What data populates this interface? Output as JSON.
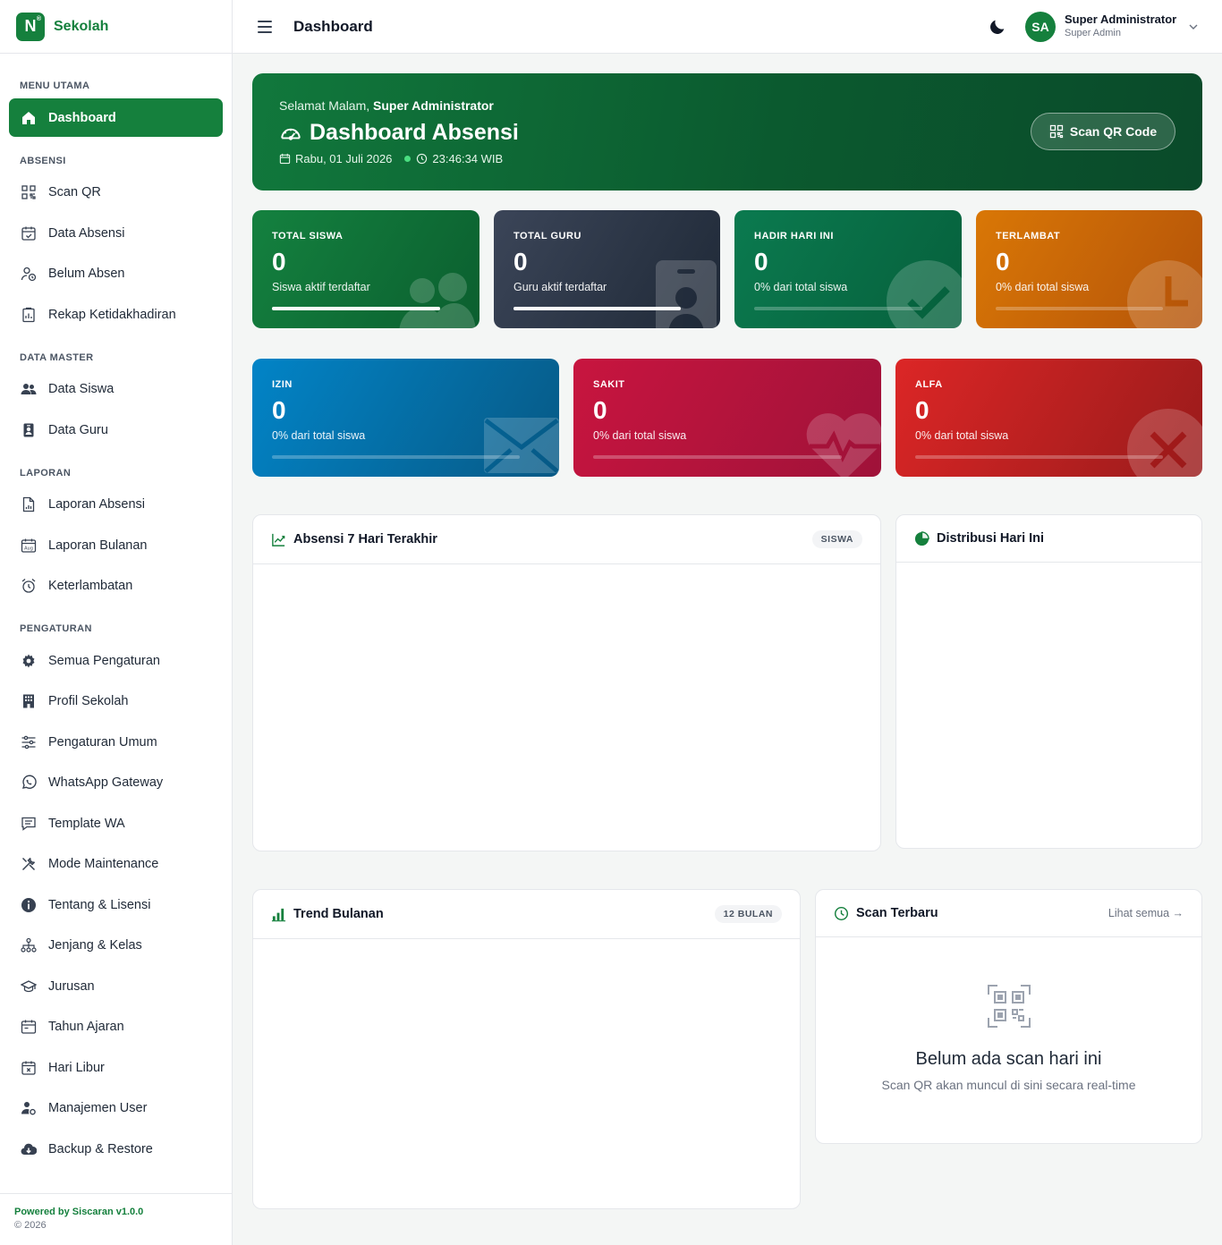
{
  "brand": {
    "logo_letter": "N",
    "logo_mark": "®",
    "name": "Sekolah"
  },
  "sidebar": {
    "sections": [
      {
        "title": "MENU UTAMA",
        "items": [
          {
            "label": "Dashboard",
            "icon": "home-icon",
            "active": true
          }
        ]
      },
      {
        "title": "ABSENSI",
        "items": [
          {
            "label": "Scan QR",
            "icon": "qr-code-icon"
          },
          {
            "label": "Data Absensi",
            "icon": "calendar-check-icon"
          },
          {
            "label": "Belum Absen",
            "icon": "user-clock-icon"
          },
          {
            "label": "Rekap Ketidakhadiran",
            "icon": "report-icon"
          }
        ]
      },
      {
        "title": "DATA MASTER",
        "items": [
          {
            "label": "Data Siswa",
            "icon": "users-icon"
          },
          {
            "label": "Data Guru",
            "icon": "id-badge-icon"
          }
        ]
      },
      {
        "title": "LAPORAN",
        "items": [
          {
            "label": "Laporan Absensi",
            "icon": "file-chart-icon"
          },
          {
            "label": "Laporan Bulanan",
            "icon": "calendar-month-icon"
          },
          {
            "label": "Keterlambatan",
            "icon": "alarm-icon"
          }
        ]
      },
      {
        "title": "PENGATURAN",
        "items": [
          {
            "label": "Semua Pengaturan",
            "icon": "gear-icon"
          },
          {
            "label": "Profil Sekolah",
            "icon": "building-icon"
          },
          {
            "label": "Pengaturan Umum",
            "icon": "sliders-icon"
          },
          {
            "label": "WhatsApp Gateway",
            "icon": "whatsapp-icon"
          },
          {
            "label": "Template WA",
            "icon": "message-icon"
          },
          {
            "label": "Mode Maintenance",
            "icon": "tools-icon"
          },
          {
            "label": "Tentang & Lisensi",
            "icon": "info-icon"
          },
          {
            "label": "Jenjang & Kelas",
            "icon": "hierarchy-icon"
          },
          {
            "label": "Jurusan",
            "icon": "graduation-cap-icon"
          },
          {
            "label": "Tahun Ajaran",
            "icon": "calendar-range-icon"
          },
          {
            "label": "Hari Libur",
            "icon": "calendar-x-icon"
          },
          {
            "label": "Manajemen User",
            "icon": "user-gear-icon"
          },
          {
            "label": "Backup & Restore",
            "icon": "cloud-download-icon"
          }
        ]
      }
    ],
    "footer": {
      "powered": "Powered by Siscaran v1.0.0",
      "copyright": "© 2026"
    }
  },
  "topbar": {
    "title": "Dashboard",
    "user_initials": "SA",
    "user_name": "Super Administrator",
    "user_role": "Super Admin"
  },
  "hero": {
    "greeting_prefix": "Selamat Malam, ",
    "greeting_name": "Super Administrator",
    "title": "Dashboard Absensi",
    "date": "Rabu, 01 Juli 2026",
    "time": "23:46:34 WIB",
    "button_label": "Scan QR Code"
  },
  "stats": [
    {
      "label": "TOTAL SISWA",
      "value": "0",
      "sub": "Siswa aktif terdaftar",
      "progress": 1.0,
      "color_from": "#14813f",
      "color_to": "#0b5f2f"
    },
    {
      "label": "TOTAL GURU",
      "value": "0",
      "sub": "Guru aktif terdaftar",
      "progress": 1.0,
      "color_from": "#3b4558",
      "color_to": "#1f2937"
    },
    {
      "label": "HADIR HARI INI",
      "value": "0",
      "sub": "0% dari total siswa",
      "progress": 0,
      "color_from": "#0b7a4f",
      "color_to": "#06603c"
    },
    {
      "label": "TERLAMBAT",
      "value": "0",
      "sub": "0% dari total siswa",
      "progress": 0,
      "color_from": "#d97706",
      "color_to": "#b45309"
    },
    {
      "label": "IZIN",
      "value": "0",
      "sub": "0% dari total siswa",
      "progress": 0,
      "color_from": "#0284c7",
      "color_to": "#075985"
    },
    {
      "label": "SAKIT",
      "value": "0",
      "sub": "0% dari total siswa",
      "progress": 0,
      "color_from": "#c8153f",
      "color_to": "#9f1239"
    },
    {
      "label": "ALFA",
      "value": "0",
      "sub": "0% dari total siswa",
      "progress": 0,
      "color_from": "#dc2626",
      "color_to": "#991b1b"
    }
  ],
  "panels": {
    "absensi7": {
      "title": "Absensi 7 Hari Terakhir",
      "badge": "SISWA"
    },
    "distribusi": {
      "title": "Distribusi Hari Ini"
    },
    "trend": {
      "title": "Trend Bulanan",
      "badge": "12 BULAN"
    },
    "scan": {
      "title": "Scan Terbaru",
      "link": "Lihat semua →",
      "empty_title": "Belum ada scan hari ini",
      "empty_sub": "Scan QR akan muncul di sini secara real-time"
    }
  },
  "colors": {
    "brand": "#15803d",
    "accent_green": "#16a34a"
  }
}
